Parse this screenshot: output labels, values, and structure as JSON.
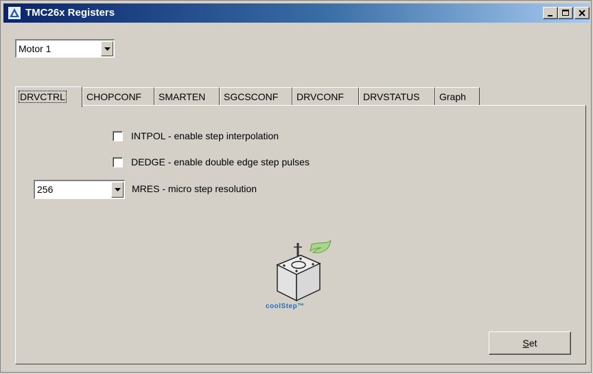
{
  "window": {
    "title": "TMC26x Registers"
  },
  "motor_select": {
    "value": "Motor 1"
  },
  "tabs": [
    {
      "label": "DRVCTRL",
      "active": true
    },
    {
      "label": "CHOPCONF"
    },
    {
      "label": "SMARTEN"
    },
    {
      "label": "SGCSCONF"
    },
    {
      "label": "DRVCONF"
    },
    {
      "label": "DRVSTATUS"
    },
    {
      "label": "Graph"
    }
  ],
  "drvctrl": {
    "intpol": {
      "label": "INTPOL - enable step interpolation",
      "checked": false
    },
    "dedge": {
      "label": "DEDGE - enable double edge step pulses",
      "checked": false
    },
    "mres": {
      "value": "256",
      "label": "MRES - micro step resolution"
    }
  },
  "logo": {
    "text": "coolStep™"
  },
  "set_button": {
    "label_before": "",
    "label_underline": "S",
    "label_after": "et"
  }
}
